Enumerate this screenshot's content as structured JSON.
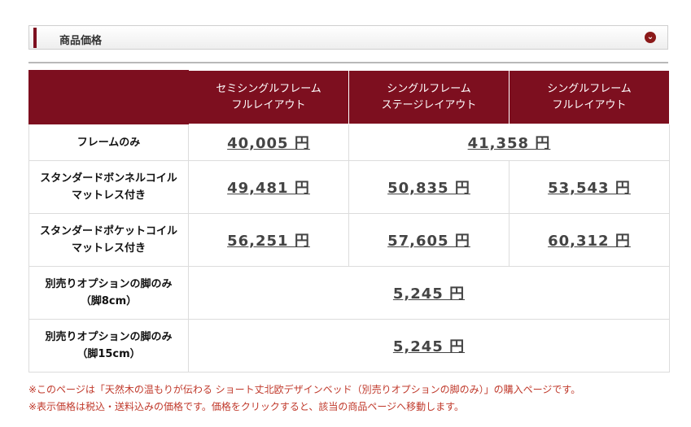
{
  "header": {
    "title": "商品価格",
    "icon": "chevron-down-circle-icon"
  },
  "table": {
    "columns": [
      [
        "セミシングルフレーム",
        "フルレイアウト"
      ],
      [
        "シングルフレーム",
        "ステージレイアウト"
      ],
      [
        "シングルフレーム",
        "フルレイアウト"
      ]
    ],
    "rows": [
      {
        "label": [
          "フレームのみ"
        ],
        "prices": [
          "40,005 円",
          "41,358 円"
        ]
      },
      {
        "label": [
          "スタンダードボンネルコイル",
          "マットレス付き"
        ],
        "prices": [
          "49,481 円",
          "50,835 円",
          "53,543 円"
        ]
      },
      {
        "label": [
          "スタンダードポケットコイル",
          "マットレス付き"
        ],
        "prices": [
          "56,251 円",
          "57,605 円",
          "60,312 円"
        ]
      },
      {
        "label": [
          "別売りオプションの脚のみ",
          "（脚8cm）"
        ],
        "prices": [
          "5,245 円"
        ]
      },
      {
        "label": [
          "別売りオプションの脚のみ",
          "（脚15cm）"
        ],
        "prices": [
          "5,245 円"
        ]
      }
    ]
  },
  "notes": [
    "※このページは「天然木の温もりが伝わる ショート丈北欧デザインベッド（別売りオプションの脚のみ）」の購入ページです。",
    "※表示価格は税込・送料込みの価格です。価格をクリックすると、該当の商品ページへ移動します。"
  ],
  "colors": {
    "accent": "#7d0f1f",
    "note": "#c0392b"
  }
}
